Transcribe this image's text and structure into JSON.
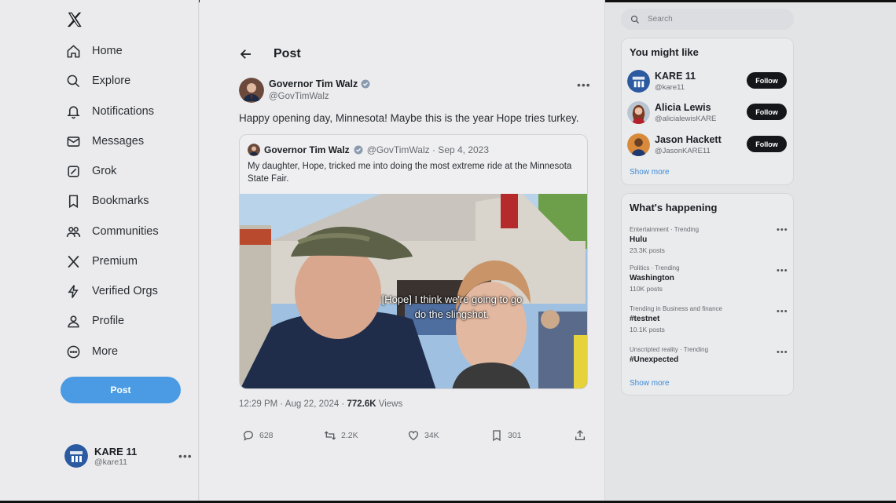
{
  "nav": {
    "items": [
      {
        "label": "Home",
        "icon": "home-icon"
      },
      {
        "label": "Explore",
        "icon": "search-icon"
      },
      {
        "label": "Notifications",
        "icon": "bell-icon"
      },
      {
        "label": "Messages",
        "icon": "envelope-icon"
      },
      {
        "label": "Grok",
        "icon": "grok-icon"
      },
      {
        "label": "Bookmarks",
        "icon": "bookmark-icon"
      },
      {
        "label": "Communities",
        "icon": "people-icon"
      },
      {
        "label": "Premium",
        "icon": "x-logo-icon"
      },
      {
        "label": "Verified Orgs",
        "icon": "lightning-icon"
      },
      {
        "label": "Profile",
        "icon": "person-icon"
      },
      {
        "label": "More",
        "icon": "more-circle-icon"
      }
    ],
    "post_button": "Post",
    "account": {
      "name": "KARE 11",
      "handle": "@kare11"
    }
  },
  "main": {
    "header": "Post",
    "post": {
      "author": "Governor Tim Walz",
      "handle": "@GovTimWalz",
      "text": "Happy opening day, Minnesota! Maybe this is the year Hope tries turkey.",
      "quote": {
        "author": "Governor Tim Walz",
        "meta": "@GovTimWalz · Sep 4, 2023",
        "text": "My daughter, Hope, tricked me into doing the most extreme ride at the Minnesota State Fair.",
        "caption_line1": "[Hope] I think we're going to go",
        "caption_line2": "do the slingshot."
      },
      "time": "12:29 PM · Aug 22, 2024 · ",
      "views_count": "772.6K",
      "views_label": " Views",
      "replies": "628",
      "reposts": "2.2K",
      "likes": "34K",
      "bookmarks": "301"
    }
  },
  "sidebar": {
    "search_placeholder": "Search",
    "might_like": {
      "title": "You might like",
      "users": [
        {
          "name": "KARE 11",
          "handle": "@kare11",
          "follow": "Follow"
        },
        {
          "name": "Alicia Lewis",
          "handle": "@alicialewisKARE",
          "follow": "Follow"
        },
        {
          "name": "Jason Hackett",
          "handle": "@JasonKARE11",
          "follow": "Follow"
        }
      ],
      "show_more": "Show more"
    },
    "happening": {
      "title": "What's happening",
      "trends": [
        {
          "category": "Entertainment · Trending",
          "name": "Hulu",
          "count": "23.3K posts"
        },
        {
          "category": "Politics · Trending",
          "name": "Washington",
          "count": "110K posts"
        },
        {
          "category": "Trending in Business and finance",
          "name": "#testnet",
          "count": "10.1K posts"
        },
        {
          "category": "Unscripted reality · Trending",
          "name": "#Unexpected",
          "count": ""
        }
      ],
      "show_more": "Show more"
    }
  },
  "colors": {
    "accent": "#4a9be3",
    "verified": "#8a9bb0",
    "follow_bg": "#141619"
  }
}
